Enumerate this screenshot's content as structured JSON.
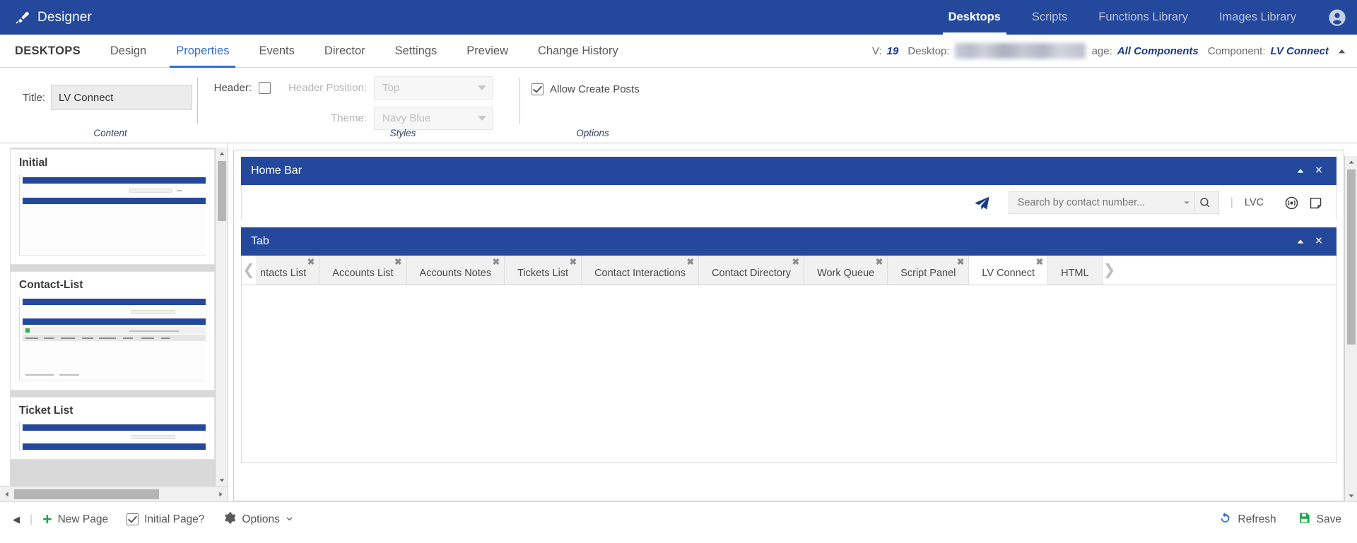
{
  "app": {
    "brand": "Designer",
    "brand_icon": "paintbrush-icon",
    "accent": "#24489c",
    "link_blue": "#2f6fd0",
    "green": "#17a74a"
  },
  "topnav": {
    "items": [
      {
        "label": "Desktops",
        "active": true
      },
      {
        "label": "Scripts",
        "active": false
      },
      {
        "label": "Functions Library",
        "active": false
      },
      {
        "label": "Images Library",
        "active": false
      }
    ],
    "account_icon": "account-circle-icon"
  },
  "subnav": {
    "items": [
      {
        "label": "DESKTOPS",
        "style": "strong"
      },
      {
        "label": "Design",
        "style": "normal"
      },
      {
        "label": "Properties",
        "style": "active"
      },
      {
        "label": "Events",
        "style": "normal"
      },
      {
        "label": "Director",
        "style": "normal"
      },
      {
        "label": "Settings",
        "style": "normal"
      },
      {
        "label": "Preview",
        "style": "normal"
      },
      {
        "label": "Change History",
        "style": "normal"
      }
    ],
    "meta": {
      "version_label": "V:",
      "version_value": "19",
      "desktop_label": "Desktop:",
      "desktop_value": "",
      "page_label": "age:",
      "page_value": "All Components",
      "component_label": "Component:",
      "component_value": "LV Connect",
      "collapse_icon": "chevron-up-icon"
    }
  },
  "ribbon": {
    "content_group": {
      "caption": "Content",
      "title_label": "Title:",
      "title_value": "LV Connect"
    },
    "styles_group": {
      "caption": "Styles",
      "header_label": "Header:",
      "header_checked": false,
      "header_position_label": "Header Position:",
      "header_position_value": "Top",
      "theme_label": "Theme:",
      "theme_value": "Navy Blue"
    },
    "options_group": {
      "caption": "Options",
      "allow_create_posts_label": "Allow Create Posts",
      "allow_create_posts_checked": true
    }
  },
  "pages": {
    "items": [
      {
        "name": "Initial"
      },
      {
        "name": "Contact-List"
      },
      {
        "name": "Ticket List"
      }
    ]
  },
  "canvas": {
    "home_bar": {
      "title": "Home Bar",
      "collapse_icon": "caret-up-icon",
      "close_icon": "close-icon",
      "send_icon": "send-plane-icon",
      "search_placeholder": "Search by contact number...",
      "search_value": "",
      "dropdown_icon": "chevron-down-icon",
      "search_icon": "magnifier-icon",
      "divider": "|",
      "lvc_label": "LVC",
      "broadcast_icon": "broadcast-icon",
      "note_icon": "note-icon"
    },
    "tab_widget": {
      "title": "Tab",
      "collapse_icon": "caret-up-icon",
      "close_icon": "close-icon",
      "prev_icon": "chevron-left-icon",
      "next_icon": "chevron-right-icon",
      "close_tab_icon": "close-icon",
      "tabs": [
        {
          "label": "ntacts List",
          "selected": false,
          "closable": true
        },
        {
          "label": "Accounts List",
          "selected": false,
          "closable": true
        },
        {
          "label": "Accounts Notes",
          "selected": false,
          "closable": true
        },
        {
          "label": "Tickets List",
          "selected": false,
          "closable": true
        },
        {
          "label": "Contact Interactions",
          "selected": false,
          "closable": true
        },
        {
          "label": "Contact Directory",
          "selected": false,
          "closable": true
        },
        {
          "label": "Work Queue",
          "selected": false,
          "closable": true
        },
        {
          "label": "Script Panel",
          "selected": false,
          "closable": true
        },
        {
          "label": "LV Connect",
          "selected": true,
          "closable": true
        },
        {
          "label": "HTML",
          "selected": false,
          "closable": false
        }
      ]
    }
  },
  "bottombar": {
    "back_icon": "caret-left-icon",
    "divider": "|",
    "new_page_label": "New Page",
    "new_page_icon": "plus-icon",
    "initial_page_label": "Initial Page?",
    "initial_page_checked": true,
    "options_label": "Options",
    "options_icon": "gear-icon",
    "options_caret": "chevron-down-icon",
    "refresh_label": "Refresh",
    "refresh_icon": "refresh-icon",
    "save_label": "Save",
    "save_icon": "floppy-disk-icon"
  }
}
